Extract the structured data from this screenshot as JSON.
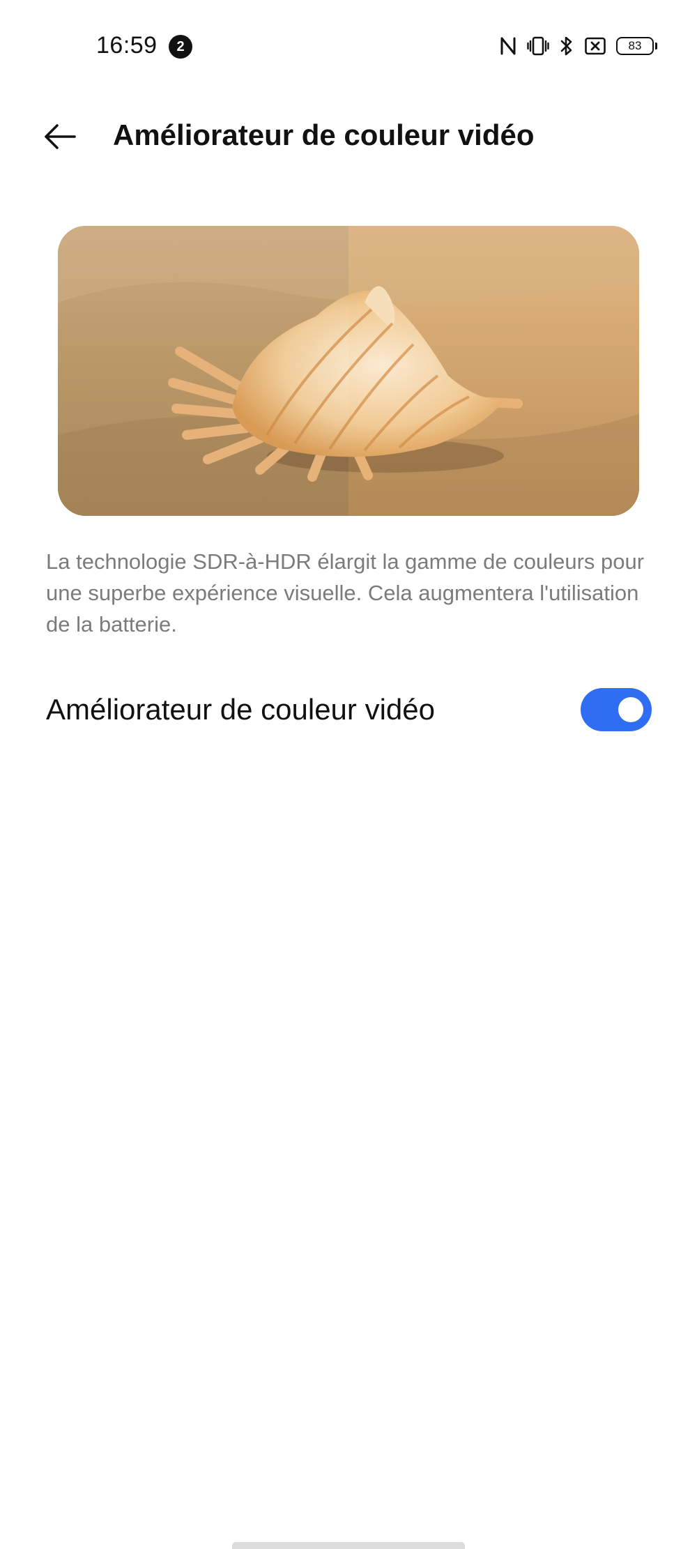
{
  "status_bar": {
    "time": "16:59",
    "notification_count": "2",
    "icons": [
      "nfc-icon",
      "vibrate-icon",
      "bluetooth-icon",
      "no-sim-icon",
      "battery-icon"
    ],
    "battery_level": "83"
  },
  "header": {
    "back_icon": "arrow-left-icon",
    "title": "Améliorateur de couleur vidéo"
  },
  "preview": {
    "image_subject": "seashell on sand, split before/after comparison"
  },
  "description": "La technologie SDR-à-HDR élargit la gamme de couleurs pour une superbe expérience visuelle. Cela augmentera l'utilisation de la batterie.",
  "setting": {
    "label": "Améliorateur de couleur vidéo",
    "enabled": true
  },
  "colors": {
    "accent": "#2f6df2",
    "description_text": "#7b7b7b"
  }
}
